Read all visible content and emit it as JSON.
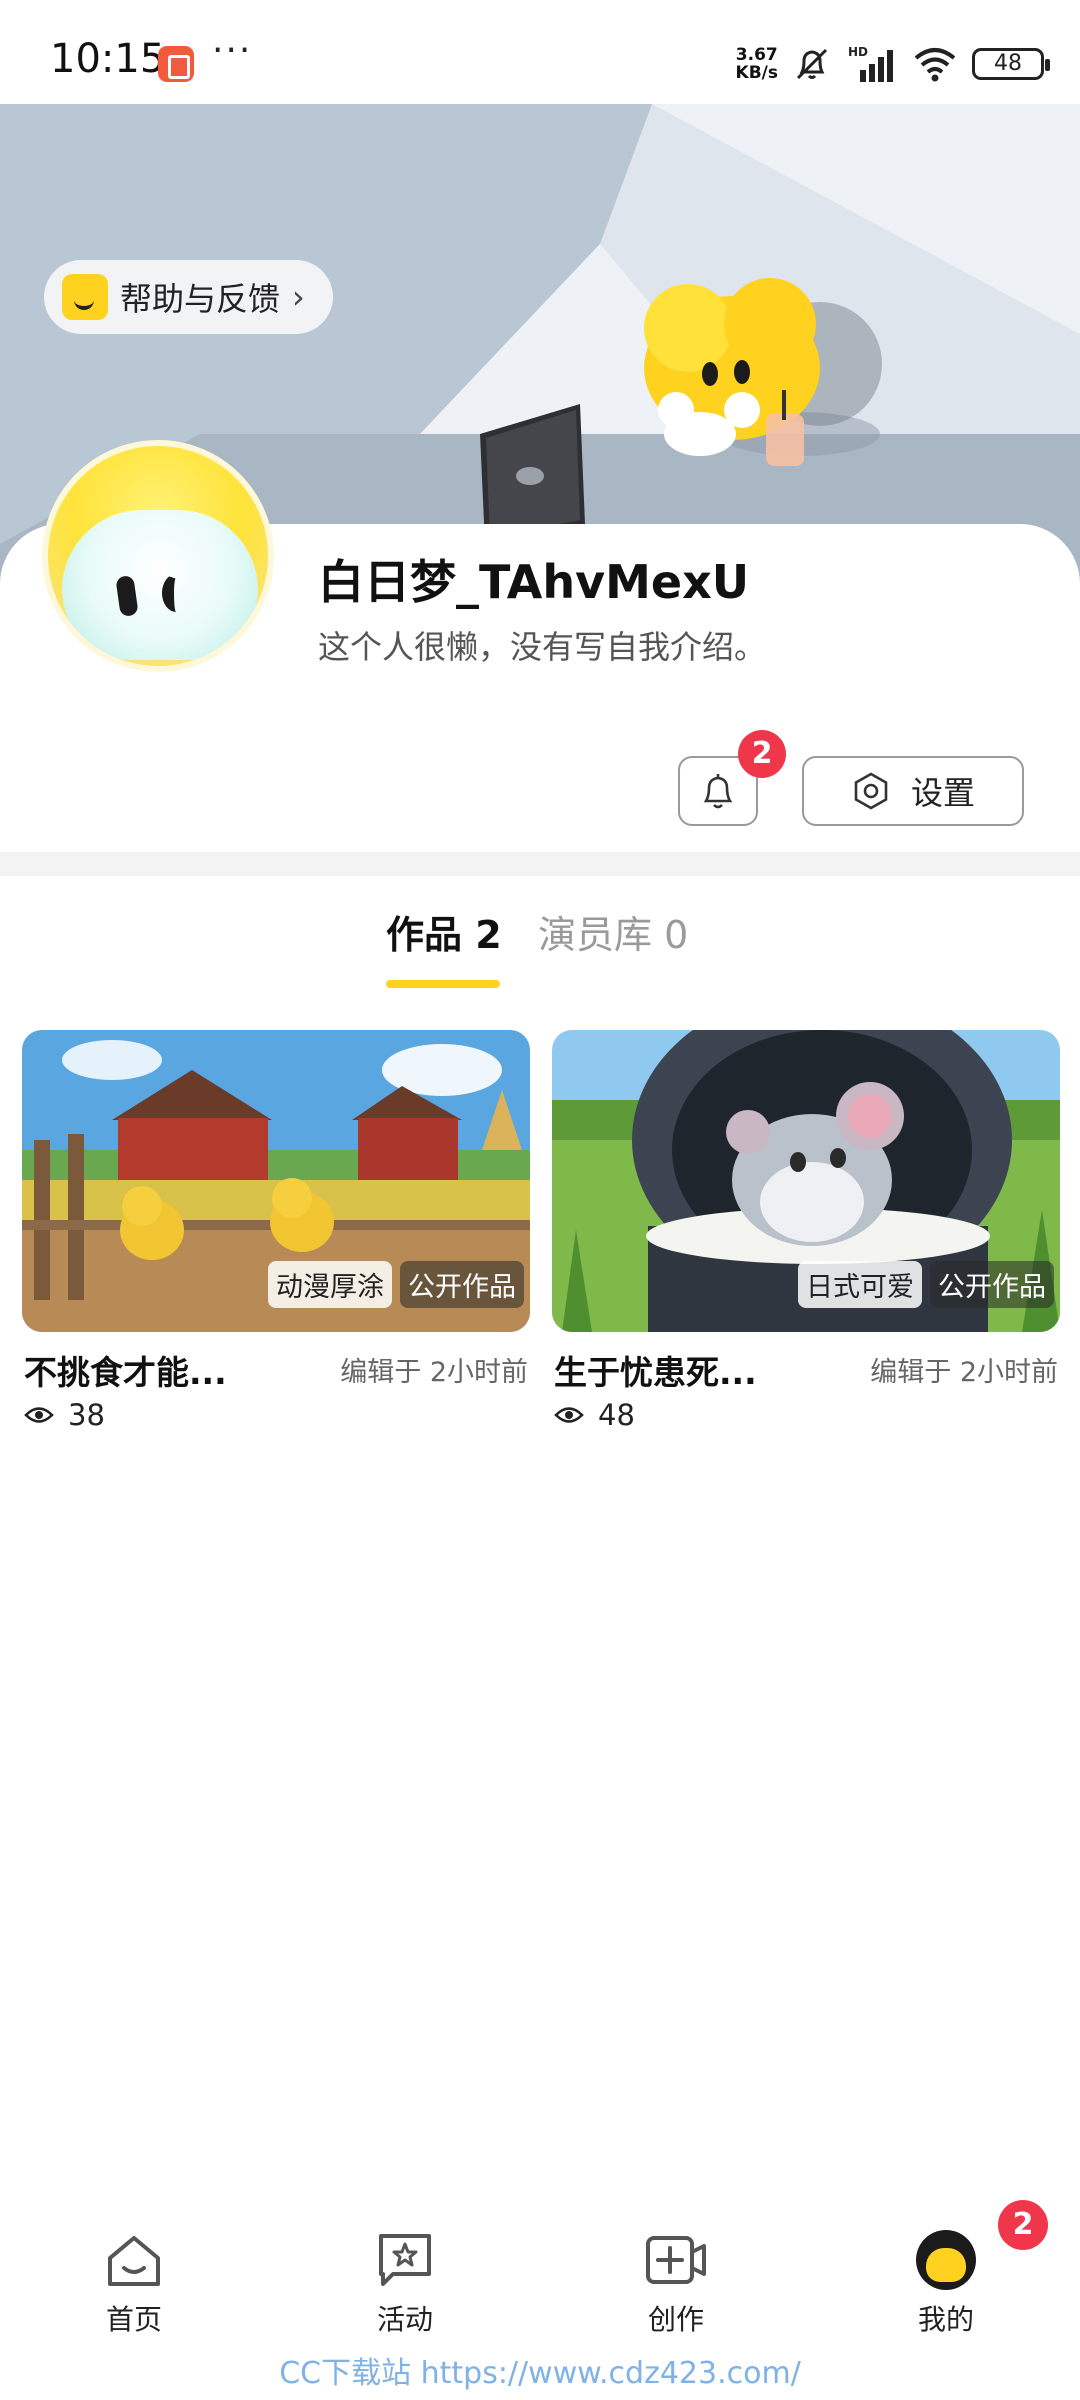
{
  "status_bar": {
    "time": "10:15",
    "net_speed_value": "3.67",
    "net_speed_unit": "KB/s",
    "network_label": "HD",
    "battery": "48"
  },
  "hero": {
    "help_label": "帮助与反馈",
    "help_chevron": "›"
  },
  "profile": {
    "username": "白日梦_TAhvMexU",
    "bio": "这个人很懒，没有写自我介绍。",
    "notification_count": "2",
    "settings_label": "设置"
  },
  "tabs": [
    {
      "label": "作品 2",
      "active": true
    },
    {
      "label": "演员库 0",
      "active": false
    }
  ],
  "works": [
    {
      "title": "不挑食才能...",
      "style_tag": "动漫厚涂",
      "visibility_tag": "公开作品",
      "edited": "编辑于 2小时前",
      "views": "38"
    },
    {
      "title": "生于忧患死...",
      "style_tag": "日式可爱",
      "visibility_tag": "公开作品",
      "edited": "编辑于 2小时前",
      "views": "48"
    }
  ],
  "nav": {
    "items": [
      {
        "label": "首页",
        "icon": "home-icon"
      },
      {
        "label": "活动",
        "icon": "activity-icon"
      },
      {
        "label": "创作",
        "icon": "create-icon"
      },
      {
        "label": "我的",
        "icon": "profile-avatar-icon"
      }
    ],
    "badge": "2"
  },
  "watermark": "CC下载站 https://www.cdz423.com/",
  "colors": {
    "accent": "#ffd21f",
    "badge": "#f0364a",
    "hero_bg": "#b9c6d4"
  }
}
